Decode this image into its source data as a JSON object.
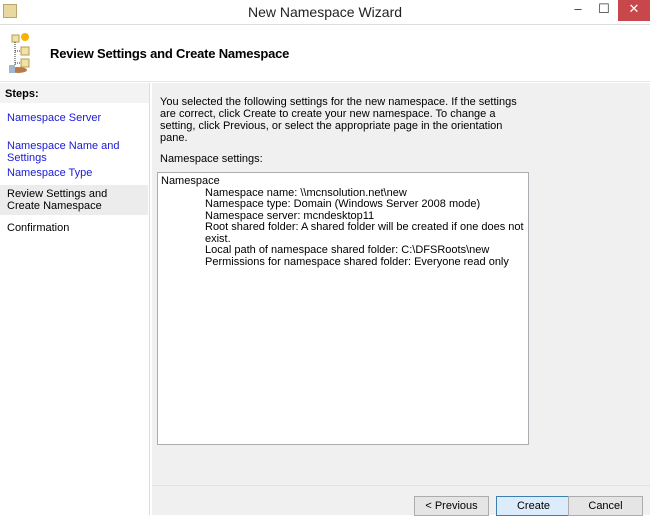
{
  "window": {
    "title": "New Namespace Wizard",
    "min": "–",
    "max": "☐",
    "close": "✕"
  },
  "header": {
    "title": "Review Settings and Create Namespace"
  },
  "steps": {
    "heading": "Steps:",
    "items": [
      {
        "label": "Namespace Server",
        "state": "link"
      },
      {
        "label": "Namespace Name and Settings",
        "state": "link"
      },
      {
        "label": "Namespace Type",
        "state": "link"
      },
      {
        "label": "Review Settings and Create Namespace",
        "state": "current"
      },
      {
        "label": "Confirmation",
        "state": "pending"
      }
    ]
  },
  "main": {
    "intro": "You selected the following settings for the new namespace. If the settings are correct, click Create to create your new namespace. To change a setting, click Previous, or select the appropriate page in the orientation pane.",
    "settings_label": "Namespace settings:",
    "settings_root": "Namespace",
    "settings": [
      "Namespace name: \\\\mcnsolution.net\\new",
      "Namespace type:  Domain (Windows Server 2008 mode)",
      "Namespace server: mcndesktop11",
      "Root shared folder:  A shared folder will be created if one does not exist.",
      "Local path of namespace shared folder: C:\\DFSRoots\\new",
      "Permissions for namespace shared folder: Everyone read only"
    ]
  },
  "buttons": {
    "previous": "< Previous",
    "create": "Create",
    "cancel": "Cancel"
  }
}
